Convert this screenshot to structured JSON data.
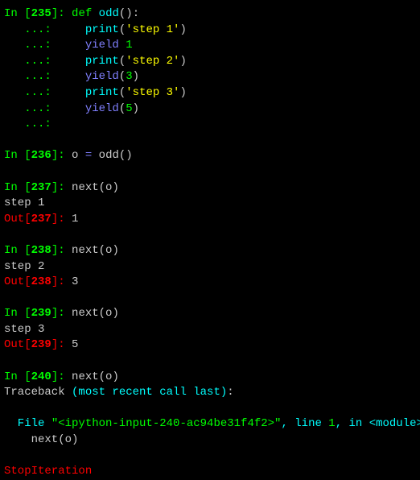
{
  "cells": [
    {
      "type": "in",
      "num": "235",
      "code_lines": [
        [
          {
            "cls": "keyword",
            "t": "def"
          },
          {
            "cls": "plain",
            "t": " "
          },
          {
            "cls": "funcname",
            "t": "odd"
          },
          {
            "cls": "plain",
            "t": "():"
          }
        ],
        [
          {
            "cls": "builtin",
            "t": "print"
          },
          {
            "cls": "plain",
            "t": "("
          },
          {
            "cls": "string",
            "t": "'step 1'"
          },
          {
            "cls": "plain",
            "t": ")"
          }
        ],
        [
          {
            "cls": "keyword-yield",
            "t": "yield"
          },
          {
            "cls": "plain",
            "t": " "
          },
          {
            "cls": "number",
            "t": "1"
          }
        ],
        [
          {
            "cls": "builtin",
            "t": "print"
          },
          {
            "cls": "plain",
            "t": "("
          },
          {
            "cls": "string",
            "t": "'step 2'"
          },
          {
            "cls": "plain",
            "t": ")"
          }
        ],
        [
          {
            "cls": "keyword-yield",
            "t": "yield"
          },
          {
            "cls": "plain",
            "t": "("
          },
          {
            "cls": "number",
            "t": "3"
          },
          {
            "cls": "plain",
            "t": ")"
          }
        ],
        [
          {
            "cls": "builtin",
            "t": "print"
          },
          {
            "cls": "plain",
            "t": "("
          },
          {
            "cls": "string",
            "t": "'step 3'"
          },
          {
            "cls": "plain",
            "t": ")"
          }
        ],
        [
          {
            "cls": "keyword-yield",
            "t": "yield"
          },
          {
            "cls": "plain",
            "t": "("
          },
          {
            "cls": "number",
            "t": "5"
          },
          {
            "cls": "plain",
            "t": ")"
          }
        ],
        []
      ]
    },
    {
      "type": "in",
      "num": "236",
      "code_lines": [
        [
          {
            "cls": "plain",
            "t": "o "
          },
          {
            "cls": "keyword-yield",
            "t": "="
          },
          {
            "cls": "plain",
            "t": " odd()"
          }
        ]
      ]
    },
    {
      "type": "in",
      "num": "237",
      "code_lines": [
        [
          {
            "cls": "plain",
            "t": "next(o)"
          }
        ]
      ],
      "stdout": "step 1",
      "out_num": "237",
      "out_val": "1"
    },
    {
      "type": "in",
      "num": "238",
      "code_lines": [
        [
          {
            "cls": "plain",
            "t": "next(o)"
          }
        ]
      ],
      "stdout": "step 2",
      "out_num": "238",
      "out_val": "3"
    },
    {
      "type": "in",
      "num": "239",
      "code_lines": [
        [
          {
            "cls": "plain",
            "t": "next(o)"
          }
        ]
      ],
      "stdout": "step 3",
      "out_num": "239",
      "out_val": "5"
    },
    {
      "type": "in",
      "num": "240",
      "code_lines": [
        [
          {
            "cls": "plain",
            "t": "next(o)"
          }
        ]
      ]
    }
  ],
  "traceback": {
    "header": "Traceback (most recent call last):",
    "file_prefix": "  File ",
    "file_str": "\"<ipython-input-240-ac94be31f4f2>\"",
    "file_mid": ", line ",
    "line_no": "1",
    "file_mid2": ", in ",
    "module": "<module>",
    "code": "    next(o)",
    "exc": "StopIteration"
  },
  "prompts": {
    "in_open": "In [",
    "in_close": "]: ",
    "out_open": "Out[",
    "out_close": "]: ",
    "cont": "   ...: "
  }
}
